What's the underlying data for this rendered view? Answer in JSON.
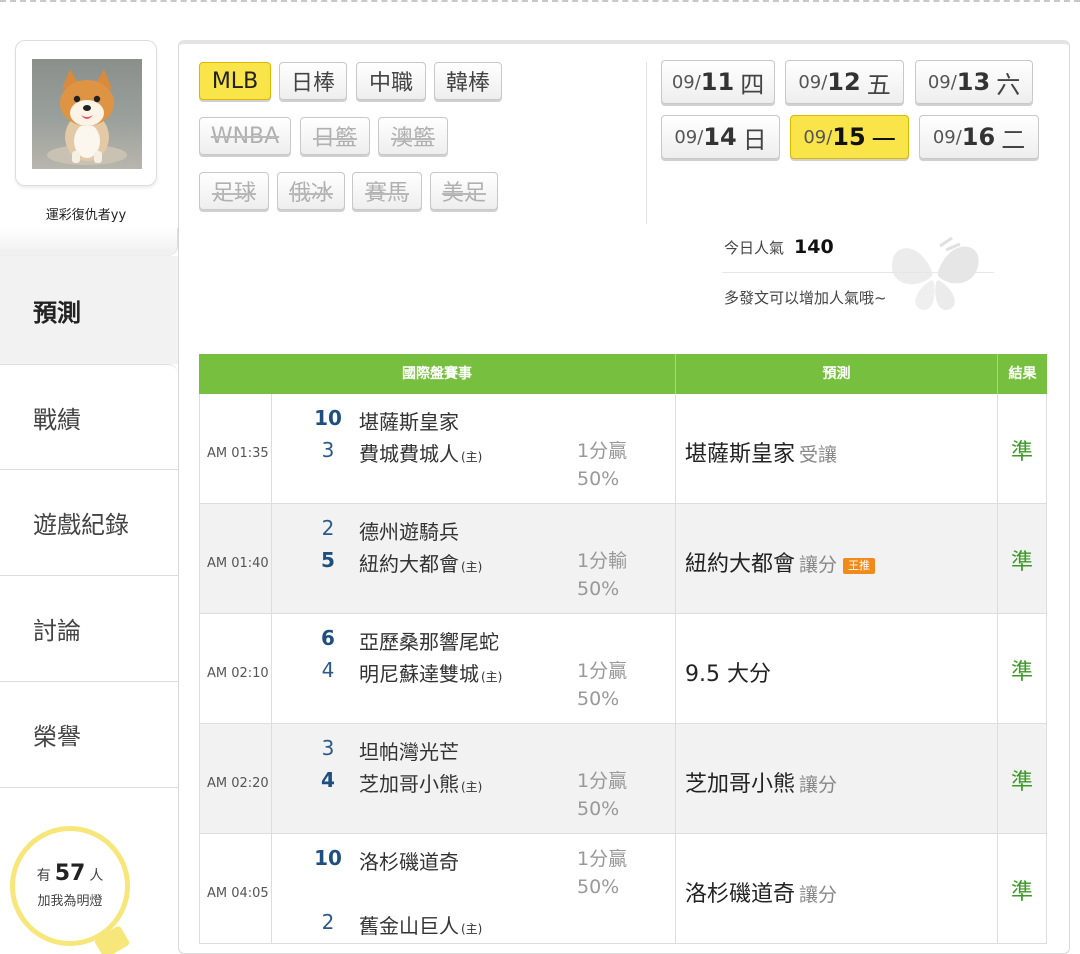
{
  "user": {
    "name": "運彩復仇者yy",
    "avatar": "shiba-dog-photo"
  },
  "nav": [
    {
      "label": "預測",
      "active": true
    },
    {
      "label": "戰績"
    },
    {
      "label": "遊戲紀錄"
    },
    {
      "label": "討論"
    },
    {
      "label": "榮譽"
    }
  ],
  "fans": {
    "prefix": "有",
    "count": "57",
    "suffix": "人",
    "caption": "加我為明燈"
  },
  "sports": [
    {
      "label": "MLB",
      "active": true
    },
    {
      "label": "日棒"
    },
    {
      "label": "中職"
    },
    {
      "label": "韓棒"
    },
    {
      "label": "WNBA",
      "disabled": true
    },
    {
      "label": "日籃",
      "disabled": true
    },
    {
      "label": "澳籃",
      "disabled": true
    },
    {
      "label": "足球",
      "disabled": true
    },
    {
      "label": "俄冰",
      "disabled": true
    },
    {
      "label": "賽馬",
      "disabled": true
    },
    {
      "label": "美足",
      "disabled": true
    }
  ],
  "dates": [
    {
      "month": "09/",
      "day": "11",
      "weekday": "四"
    },
    {
      "month": "09/",
      "day": "12",
      "weekday": "五"
    },
    {
      "month": "09/",
      "day": "13",
      "weekday": "六"
    },
    {
      "month": "09/",
      "day": "14",
      "weekday": "日"
    },
    {
      "month": "09/",
      "day": "15",
      "weekday": "一",
      "active": true
    },
    {
      "month": "09/",
      "day": "16",
      "weekday": "二"
    }
  ],
  "popularity": {
    "label": "今日人氣",
    "value": "140",
    "tip": "多發文可以增加人氣哦~"
  },
  "table": {
    "headers": {
      "event": "國際盤賽事",
      "prediction": "預測",
      "result": "結果"
    },
    "rows": [
      {
        "time": "AM 01:35",
        "away_score": "10",
        "away_team": "堪薩斯皇家",
        "home_score": "3",
        "home_team": "費城費城人",
        "home_tag": "(主)",
        "odds_line": "1分贏",
        "odds_pct": "50%",
        "pick": "堪薩斯皇家",
        "pick_sub": "受讓",
        "king": "",
        "result": "準",
        "winner": "away"
      },
      {
        "time": "AM 01:40",
        "away_score": "2",
        "away_team": "德州遊騎兵",
        "home_score": "5",
        "home_team": "紐約大都會",
        "home_tag": "(主)",
        "odds_line": "1分輸",
        "odds_pct": "50%",
        "pick": "紐約大都會",
        "pick_sub": "讓分",
        "king": "王推",
        "result": "準",
        "winner": "home"
      },
      {
        "time": "AM 02:10",
        "away_score": "6",
        "away_team": "亞歷桑那響尾蛇",
        "home_score": "4",
        "home_team": "明尼蘇達雙城",
        "home_tag": "(主)",
        "odds_line": "1分贏",
        "odds_pct": "50%",
        "pick": "9.5 大分",
        "pick_sub": "",
        "king": "",
        "result": "準",
        "winner": "away"
      },
      {
        "time": "AM 02:20",
        "away_score": "3",
        "away_team": "坦帕灣光芒",
        "home_score": "4",
        "home_team": "芝加哥小熊",
        "home_tag": "(主)",
        "odds_line": "1分贏",
        "odds_pct": "50%",
        "pick": "芝加哥小熊",
        "pick_sub": "讓分",
        "king": "",
        "result": "準",
        "winner": "home"
      },
      {
        "time": "AM 04:05",
        "away_score": "10",
        "away_team": "洛杉磯道奇",
        "home_score": "2",
        "home_team": "舊金山巨人",
        "home_tag": "(主)",
        "odds_line": "1分贏",
        "odds_pct": "50%",
        "pick": "洛杉磯道奇",
        "pick_sub": "讓分",
        "king": "",
        "result": "準",
        "winner": "away"
      }
    ]
  },
  "colors": {
    "accent_yellow": "#f9e44a",
    "header_green": "#77bf3e",
    "result_green": "#3a9a24",
    "score_blue": "#2a5a8a",
    "king_orange": "#f08a1a"
  }
}
